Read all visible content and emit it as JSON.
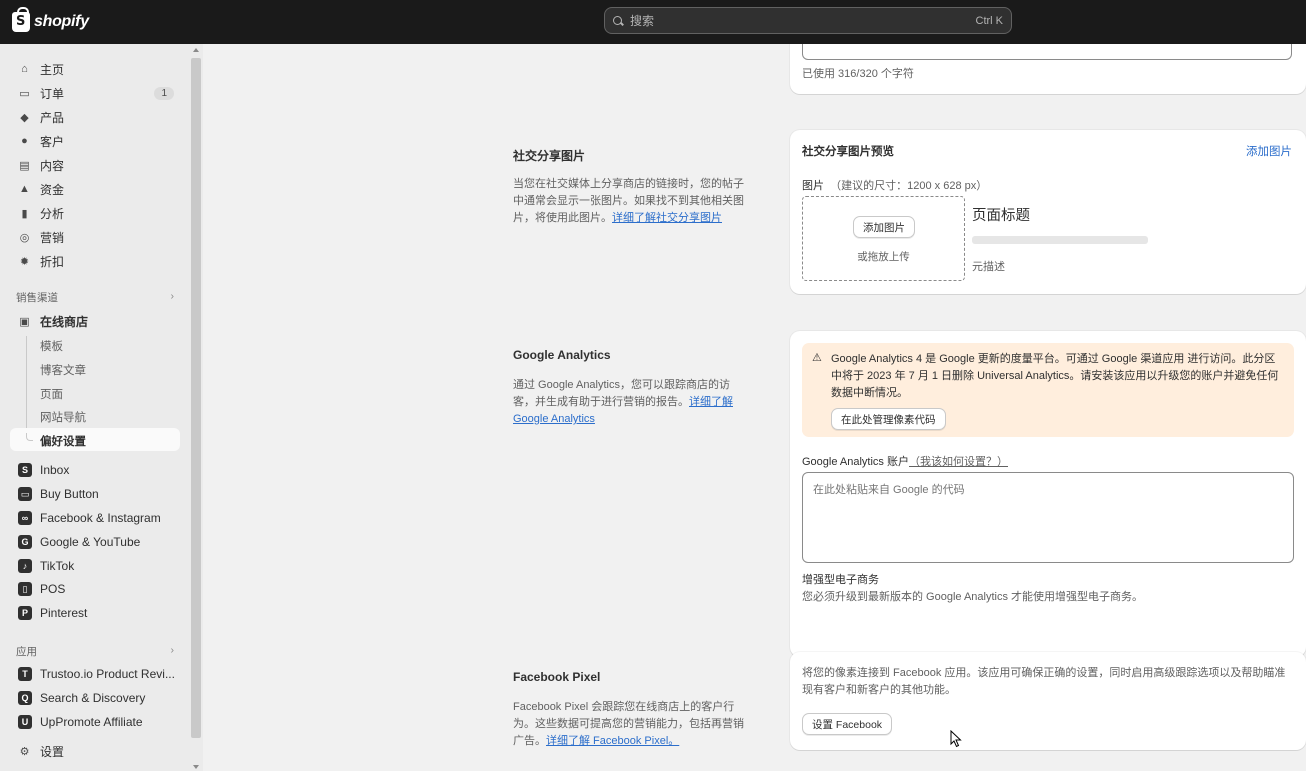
{
  "topbar": {
    "logo_text": "shopify",
    "search_placeholder": "搜索",
    "search_shortcut": "Ctrl K"
  },
  "sidebar": {
    "items": [
      {
        "label": "主页",
        "icon": "home-icon"
      },
      {
        "label": "订单",
        "icon": "inbox-icon",
        "badge": "1"
      },
      {
        "label": "产品",
        "icon": "tag-icon"
      },
      {
        "label": "客户",
        "icon": "person-icon"
      },
      {
        "label": "内容",
        "icon": "content-icon"
      },
      {
        "label": "资金",
        "icon": "bank-icon"
      },
      {
        "label": "分析",
        "icon": "bar-chart-icon"
      },
      {
        "label": "营销",
        "icon": "target-icon"
      },
      {
        "label": "折扣",
        "icon": "discount-icon"
      }
    ],
    "sales_channels_heading": "销售渠道",
    "online_store": "在线商店",
    "online_store_sub": [
      "模板",
      "博客文章",
      "页面",
      "网站导航",
      "偏好设置"
    ],
    "channels": [
      {
        "label": "Inbox",
        "icon": "inbox-app-icon"
      },
      {
        "label": "Buy Button",
        "icon": "buy-button-icon"
      },
      {
        "label": "Facebook & Instagram",
        "icon": "meta-icon"
      },
      {
        "label": "Google & YouTube",
        "icon": "google-icon"
      },
      {
        "label": "TikTok",
        "icon": "tiktok-icon"
      },
      {
        "label": "POS",
        "icon": "pos-icon"
      },
      {
        "label": "Pinterest",
        "icon": "pinterest-icon"
      }
    ],
    "apps_heading": "应用",
    "apps": [
      {
        "label": "Trustoo.io Product Revi...",
        "icon": "trustoo-icon"
      },
      {
        "label": "Search & Discovery",
        "icon": "search-discovery-icon"
      },
      {
        "label": "UpPromote Affiliate",
        "icon": "uppromote-icon"
      }
    ],
    "settings": "设置"
  },
  "main": {
    "char_count": "已使用 316/320 个字符",
    "social": {
      "title": "社交分享图片",
      "desc": "当您在社交媒体上分享商店的链接时，您的帖子中通常会显示一张图片。如果找不到其他相关图片，将使用此图片。",
      "link": "详细了解社交分享图片",
      "card_title": "社交分享图片预览",
      "add_image_link": "添加图片",
      "image_label": "图片",
      "image_hint": "（建议的尺寸：1200 x 628 px）",
      "add_image_button": "添加图片",
      "drop_text": "或拖放上传",
      "preview_title": "页面标题",
      "preview_meta": "元描述"
    },
    "ga": {
      "title": "Google Analytics",
      "desc": "通过 Google Analytics，您可以跟踪商店的访客，并生成有助于进行营销的报告。",
      "link": "详细了解 Google Analytics",
      "warning": "Google Analytics 4 是 Google 更新的度量平台。可通过 Google 渠道应用 进行访问。此分区中将于 2023 年 7 月 1 日删除 Universal Analytics。请安装该应用以升级您的账户并避免任何数据中断情况。",
      "warning_button": "在此处管理像素代码",
      "account_label": "Google Analytics 账户",
      "account_help": "（我该如何设置？）",
      "textarea_placeholder": "在此处粘贴来自 Google 的代码",
      "ecommerce_title": "增强型电子商务",
      "ecommerce_desc": "您必须升级到最新版本的 Google Analytics 才能使用增强型电子商务。"
    },
    "fb": {
      "title": "Facebook Pixel",
      "desc": "Facebook Pixel 会跟踪您在线商店上的客户行为。这些数据可提高您的营销能力，包括再营销广告。",
      "link": "详细了解 Facebook Pixel。",
      "card_text": "将您的像素连接到 Facebook 应用。该应用可确保正确的设置，同时启用高级跟踪选项以及帮助瞄准现有客户和新客户的其他功能。",
      "button": "设置 Facebook"
    }
  },
  "colors": {
    "topbar": "#1a1a1a",
    "link": "#2c6ecb",
    "warning_bg": "#ffeedd"
  }
}
